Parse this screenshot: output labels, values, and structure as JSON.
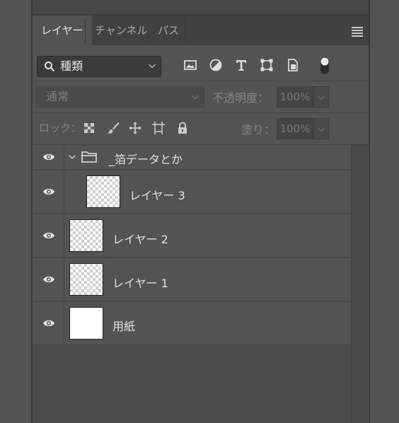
{
  "tabs": [
    {
      "label": "レイヤー",
      "active": true
    },
    {
      "label": "チャンネル",
      "active": false
    },
    {
      "label": "パス",
      "active": false
    }
  ],
  "filter": {
    "kind_label": "種類",
    "icons": [
      "image-filter-icon",
      "adjustment-filter-icon",
      "text-filter-icon",
      "shape-filter-icon",
      "smart-object-filter-icon"
    ]
  },
  "blend": {
    "mode_label": "通常",
    "opacity_label": "不透明度：",
    "opacity_value": "100%"
  },
  "lock": {
    "label": "ロック：",
    "fill_label": "塗り：",
    "fill_value": "100%"
  },
  "layers": [
    {
      "name": "_箔データとか",
      "type": "group",
      "expanded": true
    },
    {
      "name": "レイヤー 3",
      "type": "layer",
      "thumb": "transparent"
    },
    {
      "name": "レイヤー 2",
      "type": "layer",
      "thumb": "transparent"
    },
    {
      "name": "レイヤー 1",
      "type": "layer",
      "thumb": "transparent"
    },
    {
      "name": "用紙",
      "type": "layer",
      "thumb": "white"
    }
  ],
  "colors": {
    "panel_bg": "#535353",
    "tab_active": "#535353",
    "tab_bar": "#414141",
    "text": "#e2e2e2"
  }
}
